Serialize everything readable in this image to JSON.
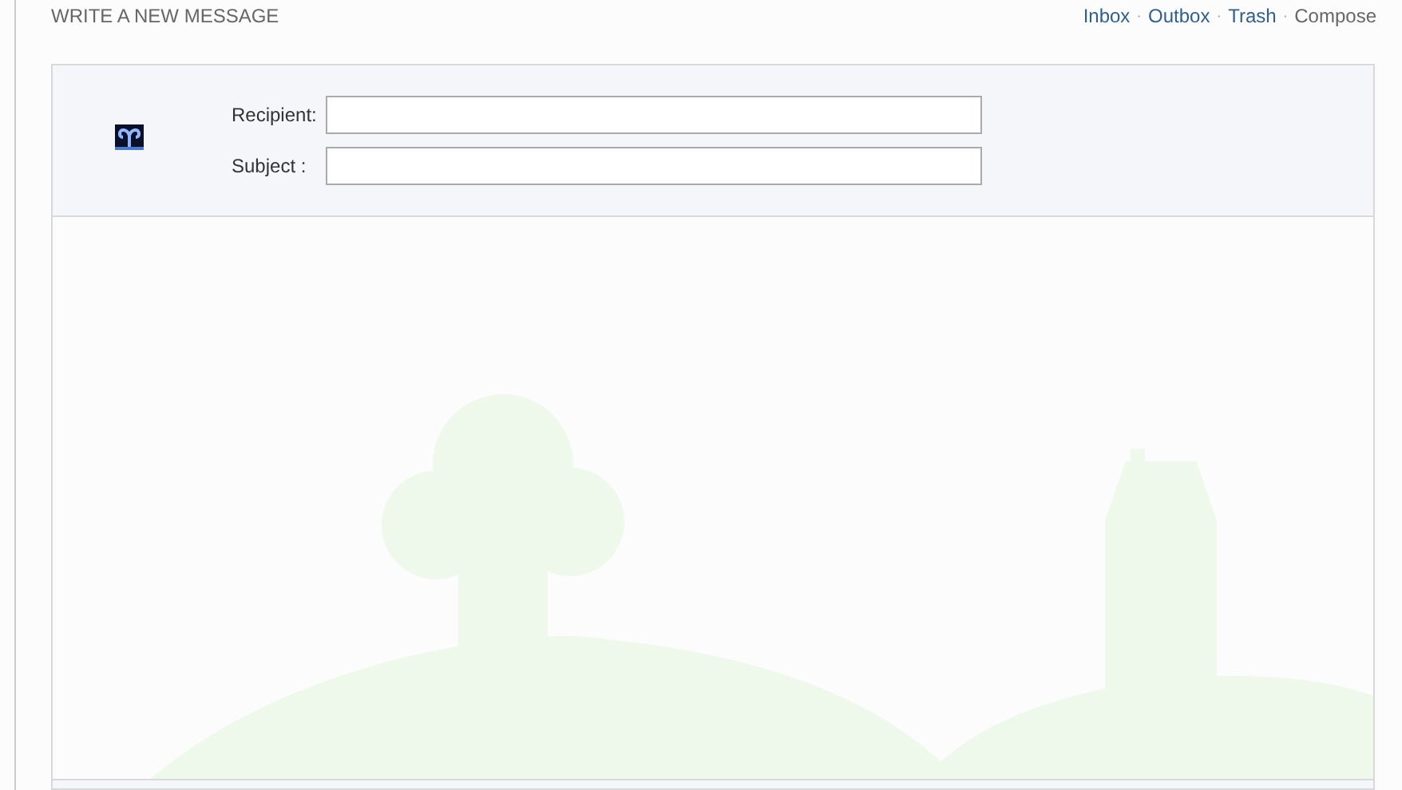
{
  "page_title": "WRITE A NEW MESSAGE",
  "nav": [
    {
      "label": "Inbox",
      "selected": false
    },
    {
      "label": "Outbox",
      "selected": false
    },
    {
      "label": "Trash",
      "selected": false
    },
    {
      "label": "Compose",
      "selected": true
    }
  ],
  "nav_separator": "·",
  "form": {
    "fields": [
      {
        "label": "Recipient:"
      },
      {
        "label": "Subject :"
      }
    ]
  }
}
